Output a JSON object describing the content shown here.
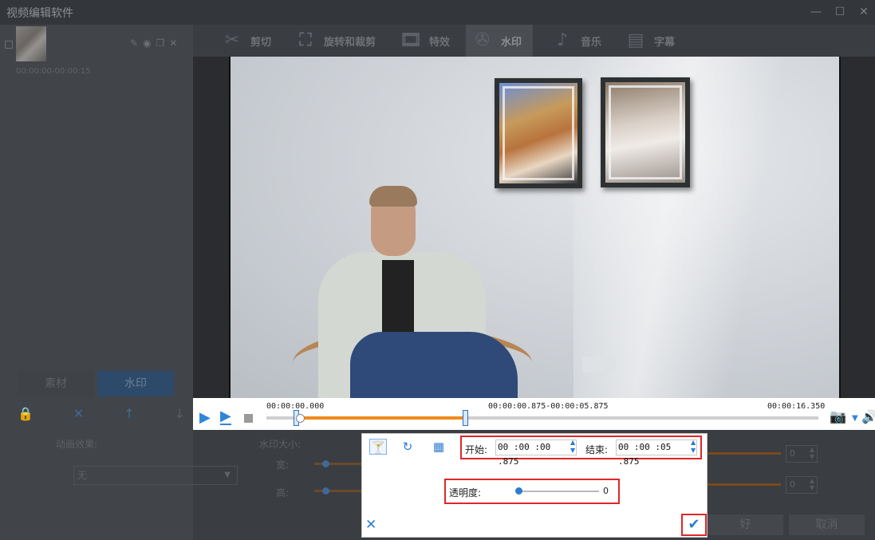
{
  "app": {
    "title": "视频编辑软件",
    "window_buttons": [
      "—",
      "☐",
      "✕"
    ]
  },
  "clip": {
    "time_range": "00:00:00-00:00:15",
    "tools": [
      "✎",
      "◉",
      "❐",
      "✕"
    ]
  },
  "feature_tabs": [
    {
      "label": "剪切",
      "icon": "scissors-icon"
    },
    {
      "label": "旋转和裁剪",
      "icon": "crop-icon"
    },
    {
      "label": "特效",
      "icon": "effects-icon"
    },
    {
      "label": "水印",
      "icon": "watermark-icon",
      "active": true
    },
    {
      "label": "音乐",
      "icon": "music-note-icon"
    },
    {
      "label": "字幕",
      "icon": "subtitle-icon"
    }
  ],
  "left_panel": {
    "tabs": [
      {
        "label": "素材"
      },
      {
        "label": "水印",
        "active": true
      }
    ],
    "tools": [
      "🔒",
      "✕",
      "↑",
      "↓"
    ],
    "animation_label": "动画效果:",
    "animation_value": "无",
    "watermark_size_label": "水印大小:",
    "width_label": "宽:",
    "height_label": "高:"
  },
  "timeline": {
    "start_time": "00:00:00.000",
    "range": "00:00:00.875-00:00:05.875",
    "end_time": "00:00:16.350",
    "selection_start_fraction": 0.053,
    "selection_end_fraction": 0.36,
    "playhead_fraction": 0.06
  },
  "right_strip": {
    "values": [
      "0",
      "0"
    ],
    "ok_label": "好",
    "cancel_label": "取消"
  },
  "popup": {
    "start_label": "开始:",
    "start_value": "00 :00 :00 .875",
    "end_label": "结束:",
    "end_value": "00 :00 :05 .875",
    "opacity_label": "透明度:",
    "opacity_value": "0",
    "opacity_fraction": 0.0
  },
  "colors": {
    "accent": "#2d7cd2",
    "highlight_border": "#e0262a",
    "timeline_fill": "#f08a1c"
  }
}
